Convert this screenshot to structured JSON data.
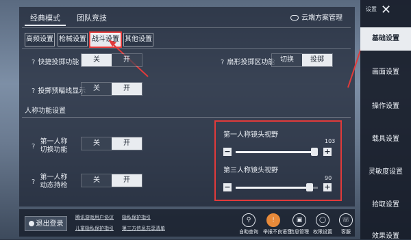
{
  "mode_tabs": [
    "经典模式",
    "团队竞技"
  ],
  "cloud_label": "云端方案管理",
  "sub_tabs": [
    "高频设置",
    "枪械设置",
    "战斗设置",
    "其他设置"
  ],
  "quick_throw": {
    "label": "快捷投掷功能",
    "off": "关",
    "on": "开"
  },
  "fan_throw": {
    "label": "扇形投掷区功能",
    "opt1": "切换",
    "opt2": "投掷"
  },
  "throw_aim": {
    "label": "投掷预瞄线显示",
    "off": "关",
    "on": "开"
  },
  "person_section": "人称功能设置",
  "first_switch": {
    "label_line1": "第一人称",
    "label_line2": "切换功能",
    "off": "关",
    "on": "开"
  },
  "first_gun": {
    "label_line1": "第一人称",
    "label_line2": "动态持枪",
    "off": "关",
    "on": "开"
  },
  "sliders": [
    {
      "title": "第一人称镜头视野",
      "value": "103",
      "fraction": 0.96
    },
    {
      "title": "第三人称镜头视野",
      "value": "90",
      "fraction": 0.9
    }
  ],
  "logout_label": "退出登录",
  "links": [
    "腾讯游戏用户协议",
    "隐私保护指引",
    "儿童隐私保护指引",
    "第三方信息共享清单"
  ],
  "footer_items": [
    "自助查询",
    "举报不良语音",
    "信息管理",
    "权限设置",
    "客服"
  ],
  "sidebar_top": "设置",
  "sidebar": [
    "基础设置",
    "画面设置",
    "操作设置",
    "载具设置",
    "灵敏度设置",
    "拾取设置",
    "效果设置"
  ],
  "annotation_color": "#e23a3a"
}
